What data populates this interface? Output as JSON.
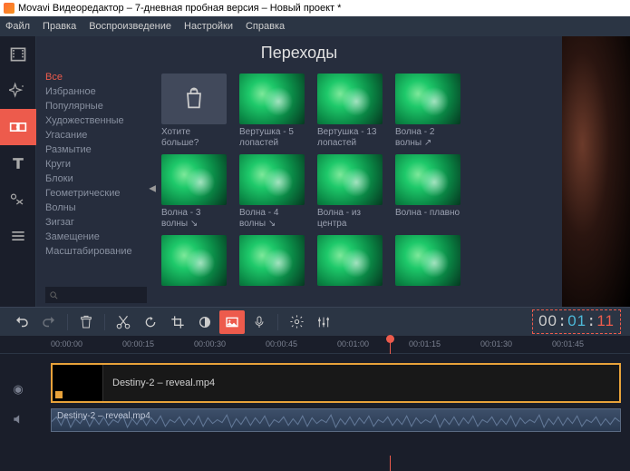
{
  "window": {
    "title": "Movavi Видеоредактор – 7-дневная пробная версия – Новый проект *"
  },
  "menu": {
    "file": "Файл",
    "edit": "Правка",
    "playback": "Воспроизведение",
    "settings": "Настройки",
    "help": "Справка"
  },
  "panel": {
    "title": "Переходы"
  },
  "categories": {
    "items": [
      {
        "label": "Все",
        "active": true
      },
      {
        "label": "Избранное"
      },
      {
        "label": "Популярные"
      },
      {
        "label": "Художественные"
      },
      {
        "label": "Угасание"
      },
      {
        "label": "Размытие"
      },
      {
        "label": "Круги"
      },
      {
        "label": "Блоки"
      },
      {
        "label": "Геометрические"
      },
      {
        "label": "Волны"
      },
      {
        "label": "Зигзаг"
      },
      {
        "label": "Замещение"
      },
      {
        "label": "Масштабирование"
      }
    ]
  },
  "transitions": {
    "row1": [
      {
        "label": "Хотите больше?",
        "promo": true
      },
      {
        "label": "Вертушка - 5 лопастей"
      },
      {
        "label": "Вертушка - 13 лопастей"
      },
      {
        "label": "Волна - 2 волны ↗"
      }
    ],
    "row2": [
      {
        "label": "Волна - 3 волны ↘"
      },
      {
        "label": "Волна - 4 волны ↘"
      },
      {
        "label": "Волна - из центра"
      },
      {
        "label": "Волна - плавно"
      }
    ]
  },
  "timecode": {
    "h": "00",
    "m": "01",
    "s": "11"
  },
  "ruler": [
    "00:00:00",
    "00:00:15",
    "00:00:30",
    "00:00:45",
    "00:01:00",
    "00:01:15",
    "00:01:30",
    "00:01:45"
  ],
  "clips": {
    "video": {
      "label": "Destiny-2 – reveal.mp4"
    },
    "audio": {
      "label": "Destiny-2 – reveal.mp4"
    }
  }
}
